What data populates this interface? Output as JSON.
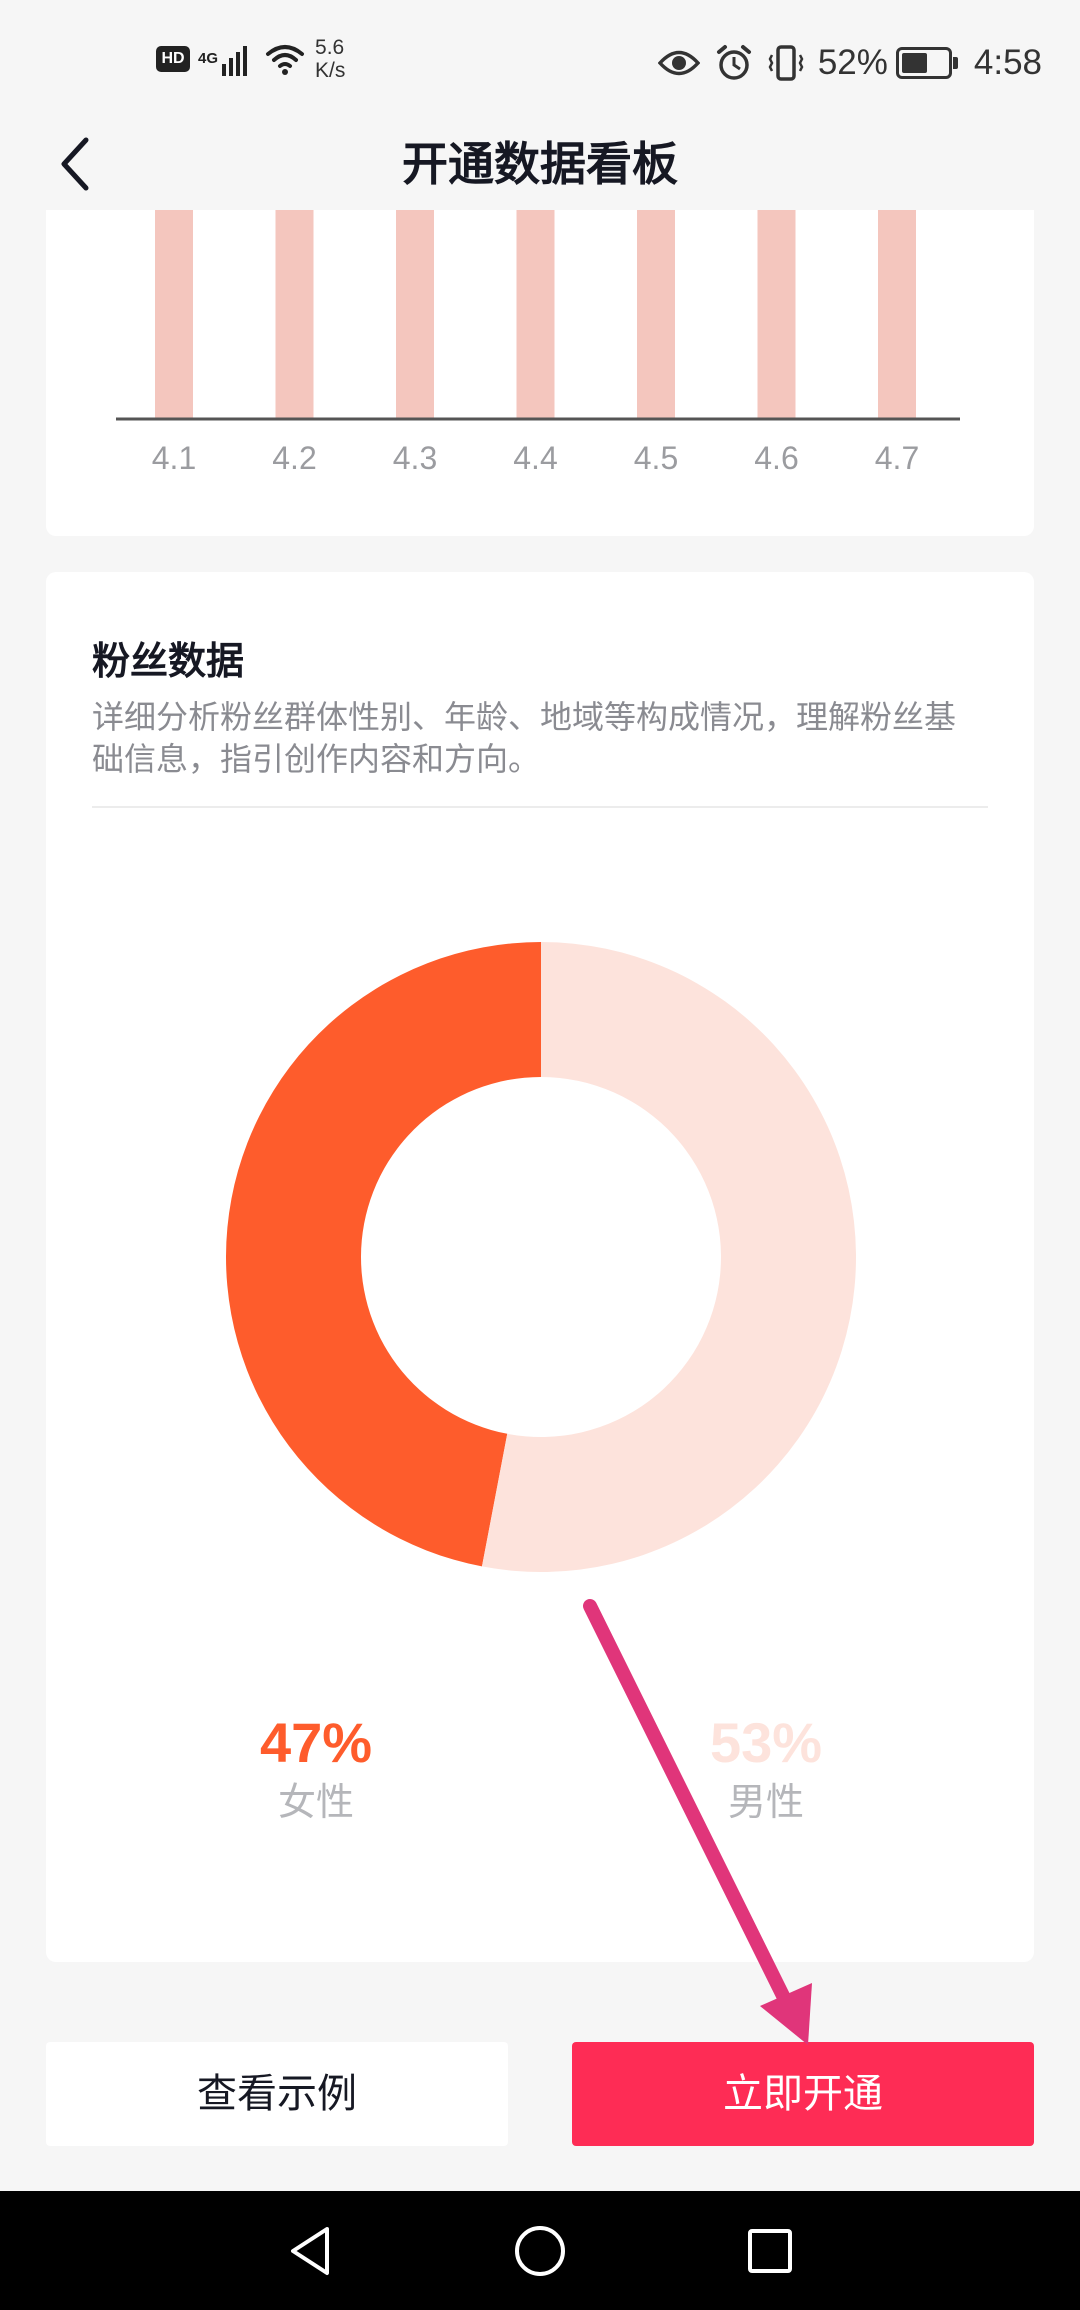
{
  "status_bar": {
    "hd_badge": "HD",
    "network_type": "4G",
    "net_speed_value": "5.6",
    "net_speed_unit": "K/s",
    "battery_percent": "52%",
    "time": "4:58",
    "icons": [
      "signal-icon",
      "wifi-icon",
      "eye-icon",
      "alarm-icon",
      "vibrate-icon",
      "battery-icon"
    ]
  },
  "nav": {
    "title": "开通数据看板",
    "back_icon": "chevron-left-icon"
  },
  "chart_data": {
    "type": "bar",
    "categories": [
      "4.1",
      "4.2",
      "4.3",
      "4.4",
      "4.5",
      "4.6",
      "4.7"
    ],
    "bar_color": "#f4c6be",
    "cropped_top": true
  },
  "fans": {
    "title": "粉丝数据",
    "description": "详细分析粉丝群体性别、年龄、地域等构成情况，理解粉丝基础信息，指引创作内容和方向。",
    "donut_chart": {
      "type": "pie",
      "labels": [
        "女性",
        "男性"
      ],
      "values": [
        47,
        53
      ],
      "colors": [
        "#fe5c2c",
        "#fde3dc"
      ]
    },
    "legend": [
      {
        "percent": "47%",
        "label": "女性",
        "color": "#fe5c2c"
      },
      {
        "percent": "53%",
        "label": "男性",
        "color": "#fde3dc"
      }
    ]
  },
  "buttons": {
    "example": "查看示例",
    "activate": "立即开通"
  },
  "annotation": {
    "color": "#e0357a",
    "type": "arrow"
  },
  "system_nav": {
    "icons": [
      "back-triangle-icon",
      "home-circle-icon",
      "recents-square-icon"
    ]
  }
}
